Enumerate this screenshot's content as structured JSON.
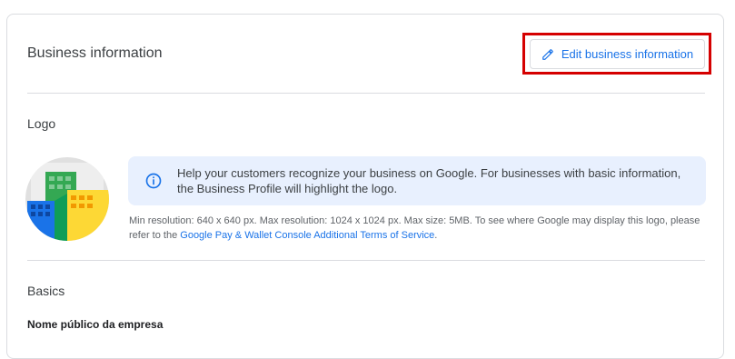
{
  "card": {
    "title": "Business information",
    "edit_button_label": "Edit business information"
  },
  "logo_section": {
    "heading": "Logo",
    "info_text": "Help your customers recognize your business on Google. For businesses with basic information, the Business Profile will highlight the logo.",
    "requirements_text": "Min resolution: 640 x 640 px. Max resolution: 1024 x 1024 px. Max size: 5MB. To see where Google may display this logo, please refer to the",
    "terms_link": "Google Pay & Wallet Console Additional Terms of Service",
    "requirements_suffix": "."
  },
  "basics_section": {
    "heading": "Basics",
    "public_name_label": "Nome público da empresa"
  },
  "colors": {
    "accent": "#1a73e8",
    "highlight": "#d50000",
    "info_bg": "#e8f0fe"
  }
}
